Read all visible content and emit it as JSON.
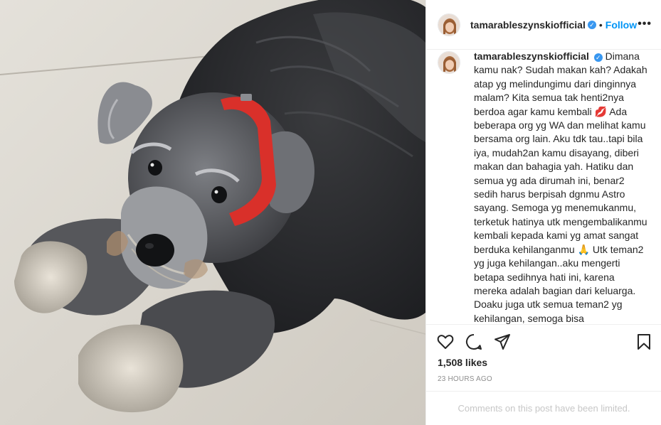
{
  "post": {
    "username": "tamarableszynskiofficial",
    "follow_label": "Follow",
    "separator": "•",
    "more_label": "•••",
    "caption": "Dimana kamu nak? Sudah makan kah? Adakah atap yg melindungimu dari dinginnya malam? Kita semua tak henti2nya berdoa agar kamu kembali 💋 Ada beberapa org yg WA dan melihat kamu bersama org lain. Aku tdk tau..tapi bila iya, mudah2an kamu disayang, diberi makan dan bahagia yah. Hatiku dan semua yg ada dirumah ini, benar2 sedih harus berpisah dgnmu Astro sayang. Semoga yg menemukanmu, terketuk hatinya utk mengembalikanmu kembali kepada kami yg amat sangat berduka kehilanganmu 🙏 Utk teman2 yg juga kehilangan..aku mengerti betapa sedihnya hati ini, karena mereka adalah bagian dari keluarga. Doaku juga utk semua teman2 yg kehilangan, semoga bisa",
    "likes": "1,508 likes",
    "time": "23 HOURS AGO",
    "comments_notice": "Comments on this post have been limited."
  },
  "icons": {
    "verified": "verified-badge-icon",
    "like": "heart-icon",
    "comment": "comment-bubble-icon",
    "share": "paper-plane-icon",
    "save": "bookmark-icon"
  },
  "colors": {
    "link": "#0095f6",
    "verified": "#3897f0",
    "border": "#efefef",
    "muted": "#8e8e8e",
    "disabled_text": "#c7c7c7",
    "collar": "#d9302a"
  }
}
